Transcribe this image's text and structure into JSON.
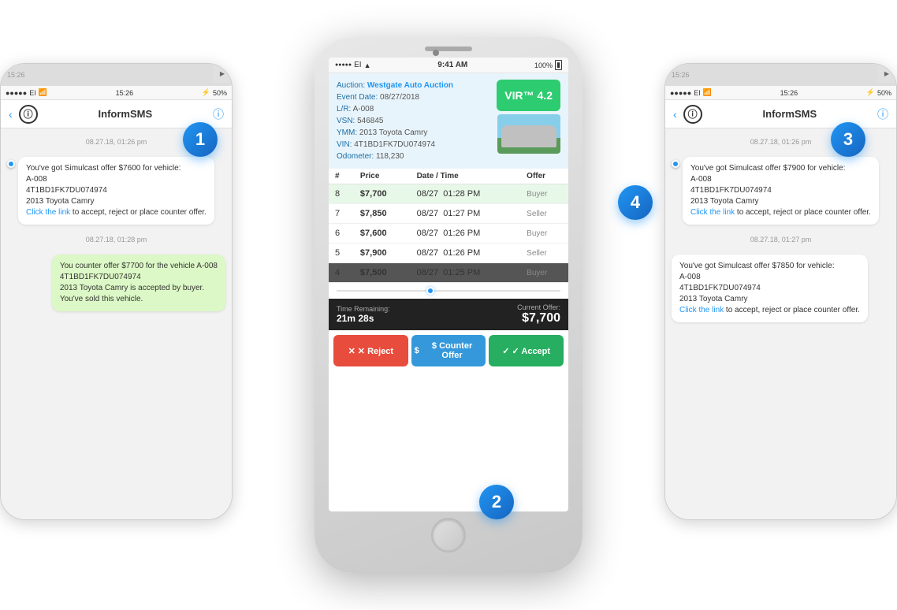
{
  "scene": {
    "badges": [
      "1",
      "2",
      "3",
      "4"
    ]
  },
  "phone_center": {
    "status_bar": {
      "dots": "●●●●●",
      "carrier": "EI",
      "wifi": "WiFi",
      "time": "9:41 AM",
      "battery": "100%"
    },
    "auction": {
      "label_auction": "Auction:",
      "auction_name": "Westgate Auto Auction",
      "label_event": "Event Date:",
      "event_date": "08/27/2018",
      "label_lr": "L/R:",
      "lr_value": "A-008",
      "label_vsn": "VSN:",
      "vsn_value": "546845",
      "label_ymm": "YMM:",
      "ymm_value": "2013 Toyota Camry",
      "label_vin": "VIN:",
      "vin_value": "4T1BD1FK7DU074974",
      "label_odometer": "Odometer:",
      "odometer_value": "118,230",
      "vir_badge": "VIR™ 4.2"
    },
    "table": {
      "headers": [
        "#",
        "Price",
        "Date / Time",
        "Offer"
      ],
      "rows": [
        {
          "num": "8",
          "price": "$7,700",
          "date": "08/27",
          "time": "01:28 PM",
          "offer": "Buyer",
          "highlight": true
        },
        {
          "num": "7",
          "price": "$7,850",
          "date": "08/27",
          "time": "01:27 PM",
          "offer": "Seller",
          "highlight": false
        },
        {
          "num": "6",
          "price": "$7,600",
          "date": "08/27",
          "time": "01:26 PM",
          "offer": "Buyer",
          "highlight": false
        },
        {
          "num": "5",
          "price": "$7,900",
          "date": "08/27",
          "time": "01:26 PM",
          "offer": "Seller",
          "highlight": false
        },
        {
          "num": "4",
          "price": "$7,500",
          "date": "08/27",
          "time": "01:25 PM",
          "offer": "Buyer",
          "highlight": false,
          "partial": true
        }
      ]
    },
    "timer": {
      "label_time": "Time Remaining:",
      "time_value": "21m 28s",
      "label_offer": "Current Offer:",
      "offer_value": "$7,700"
    },
    "buttons": {
      "reject": "✕  Reject",
      "counter": "$  Counter Offer",
      "accept": "✓  Accept"
    }
  },
  "phone_left": {
    "status_bar": {
      "dots": "●●●●●",
      "carrier": "EI",
      "wifi": "WiFi",
      "time": "15:26"
    },
    "header_title": "InformSMS",
    "messages": [
      {
        "timestamp": "08.27.18, 01:26 pm",
        "type": "received",
        "text": "You've got Simulcast offer $7600 for vehicle:\nA-008\n4T1BD1FK7DU074974\n2013 Toyota Camry\n",
        "link": "Click the link",
        "link_suffix": " to accept, reject or place counter offer."
      },
      {
        "timestamp": "08.27.18, 01:28 pm",
        "type": "sent",
        "text": "You counter offer $7700 for the vehicle A-008\n4T1BD1FK7DU074974\n2013 Toyota Camry is accepted by buyer.\nYou've sold this vehicle."
      }
    ]
  },
  "phone_right": {
    "status_bar": {
      "dots": "●●●●●",
      "carrier": "EI",
      "wifi": "WiFi",
      "time": "15:26"
    },
    "header_title": "InformSMS",
    "messages": [
      {
        "timestamp": "08.27.18, 01:26 pm",
        "type": "received",
        "text": "You've got Simulcast offer $7900 for vehicle:\nA-008\n4T1BD1FK7DU074974\n2013 Toyota Camry\n",
        "link": "Click the link",
        "link_suffix": " to accept, reject or place counter offer."
      },
      {
        "timestamp": "08.27.18, 01:27 pm",
        "type": "received",
        "text": "You've got Simulcast offer $7850 for vehicle:\nA-008\n4T1BD1FK7DU074974\n2013 Toyota Camry\n",
        "link": "Click the link",
        "link_suffix": " to accept, reject or place counter offer."
      }
    ]
  }
}
